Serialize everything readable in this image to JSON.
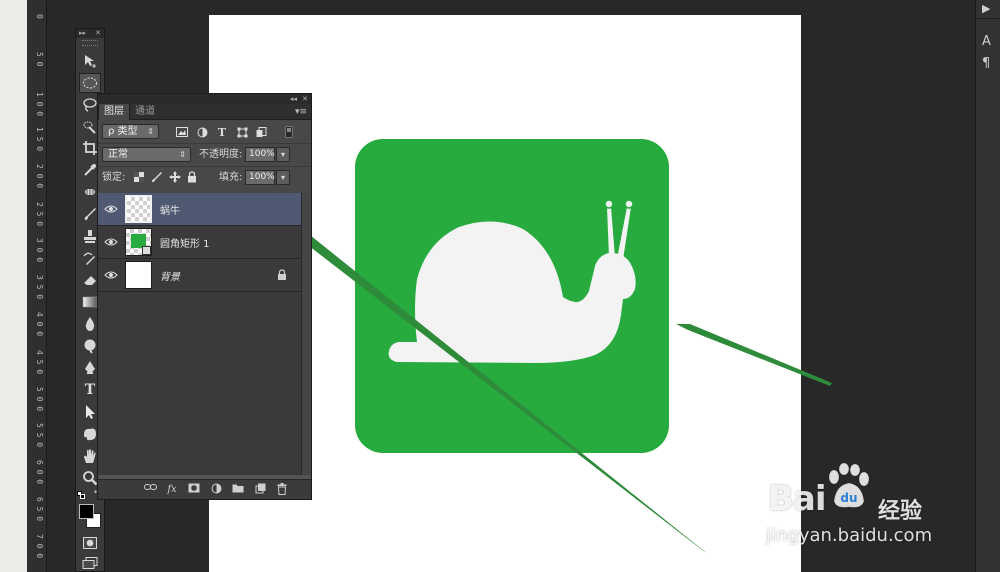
{
  "window": {
    "zoom_ruler_ticks": [
      "0",
      "5 0",
      "1 0 0",
      "1 5 0",
      "2 0 0",
      "2 5 0",
      "3 0 0",
      "3 5 0",
      "4 0 0",
      "4 5 0",
      "5 0 0",
      "5 5 0",
      "6 0 0",
      "6 5 0",
      "7 0 0"
    ]
  },
  "right_dock": {
    "items": [
      "▶",
      "A",
      "¶"
    ]
  },
  "toolbox": {
    "tools": [
      "move-tool",
      "elliptical-marquee-tool",
      "lasso-tool",
      "quick-selection-tool",
      "crop-tool",
      "eyedropper-tool",
      "spot-healing-brush-tool",
      "brush-tool",
      "clone-stamp-tool",
      "history-brush-tool",
      "eraser-tool",
      "gradient-tool",
      "blur-tool",
      "dodge-tool",
      "pen-tool",
      "type-tool",
      "path-selection-tool",
      "custom-shape-tool",
      "hand-tool",
      "zoom-tool"
    ],
    "type_tool_glyph": "T",
    "foreground_color": "#000000",
    "background_color": "#ffffff"
  },
  "layers_panel": {
    "tabs": [
      "图层",
      "通道"
    ],
    "active_tab": "图层",
    "filter_kind": "ρ 类型",
    "filter_type_glyph": "T",
    "blend_mode": "正常",
    "opacity_label": "不透明度:",
    "opacity_value": "100%",
    "lock_label": "锁定:",
    "fill_label": "填充:",
    "fill_value": "100%",
    "layers": [
      {
        "name": "蜗牛",
        "selected": true,
        "thumb": "transparent"
      },
      {
        "name": "圆角矩形 1",
        "selected": false,
        "thumb": "shape"
      },
      {
        "name": "背景",
        "selected": false,
        "thumb": "white",
        "italic": true,
        "locked": true
      }
    ],
    "footer_buttons": [
      "link-layers",
      "fx",
      "add-mask",
      "adjustment-layer",
      "group",
      "new-layer",
      "delete-layer"
    ],
    "footer_fx_label": "fx"
  },
  "artwork": {
    "rounded_rect_color": "#27ab3f",
    "snail_color": "#f3f3f3",
    "arrow_color": "#2e8b3a"
  },
  "watermark": {
    "brand": "Bai",
    "brand_suffix": "du",
    "product": "经验",
    "url": "jingyan.baidu.com"
  }
}
